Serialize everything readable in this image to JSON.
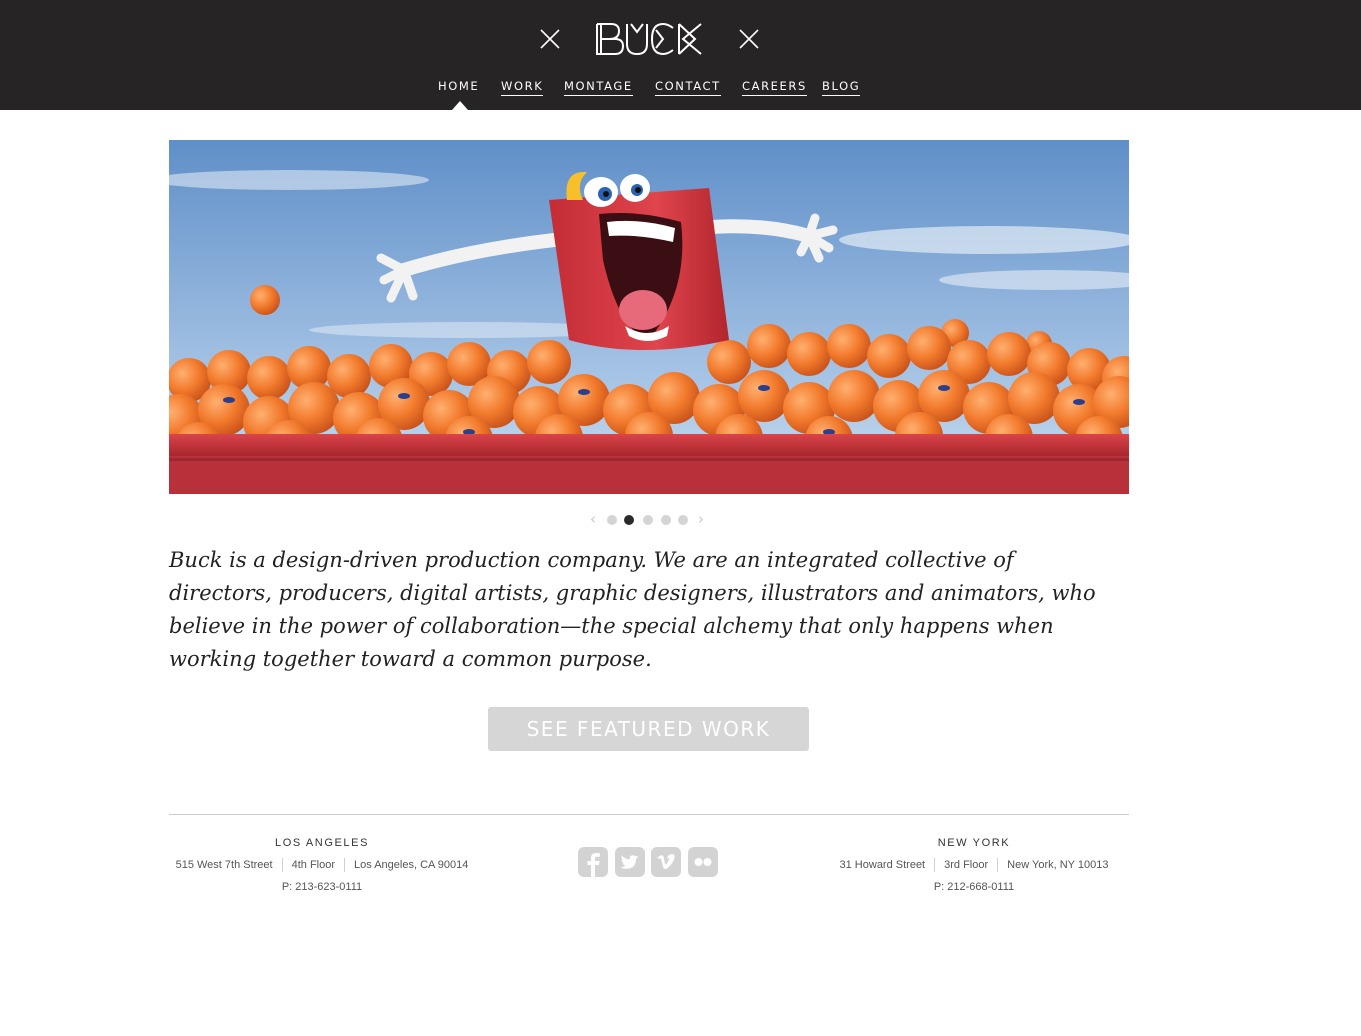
{
  "header": {
    "brand": "BUCK",
    "nav": [
      {
        "label": "HOME",
        "active": true
      },
      {
        "label": "WORK",
        "active": false
      },
      {
        "label": "MONTAGE",
        "active": false
      },
      {
        "label": "CONTACT",
        "active": false
      },
      {
        "label": "CAREERS",
        "active": false
      },
      {
        "label": "BLOG",
        "active": false
      }
    ]
  },
  "hero": {
    "slider": {
      "prev_label": "‹",
      "next_label": "›",
      "slide_count": 5,
      "active_slide": 2
    }
  },
  "intro": {
    "text": "Buck is a design-driven production company. We are an integrated collective of directors, producers, digital artists, graphic designers, illustrators and animators, who believe in the power of collaboration—the special alchemy that only happens when working together toward a common purpose."
  },
  "cta": {
    "label": "SEE FEATURED WORK"
  },
  "footer": {
    "los_angeles": {
      "city": "LOS ANGELES",
      "street": "515 West 7th Street",
      "floor": "4th Floor",
      "locality": "Los Angeles, CA 90014",
      "phone": "P: 213-623-0111"
    },
    "new_york": {
      "city": "NEW YORK",
      "street": "31 Howard Street",
      "floor": "3rd Floor",
      "locality": "New York, NY 10013",
      "phone": "P: 212-668-0111"
    },
    "social": [
      "facebook-icon",
      "twitter-icon",
      "vimeo-icon",
      "flickr-icon"
    ]
  },
  "colors": {
    "header_bg": "#262424",
    "cta_bg": "#d6d6d6",
    "dot_active": "#2a2a2a",
    "dot_inactive": "#d4d4d4"
  }
}
